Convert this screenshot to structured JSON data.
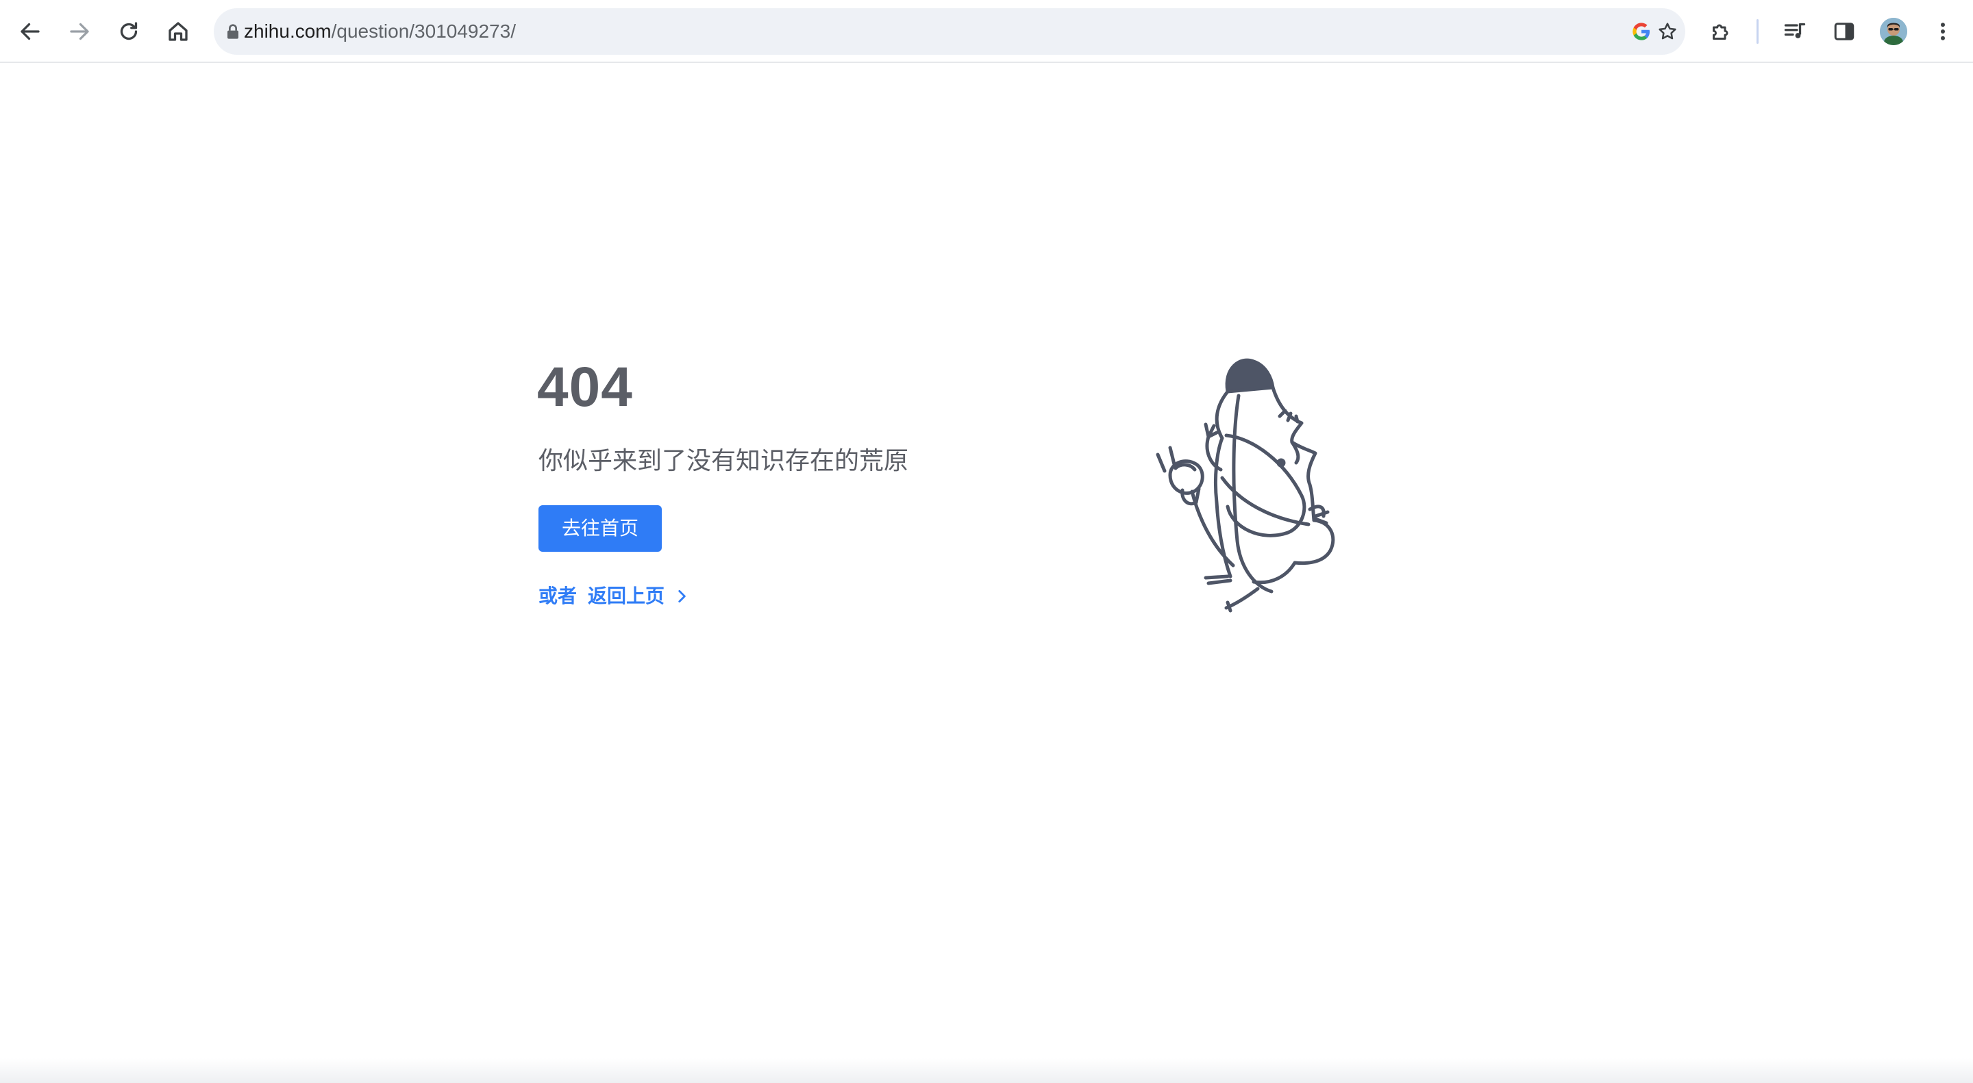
{
  "browser": {
    "url_host": "zhihu.com",
    "url_path": "/question/301049273/",
    "icons": {
      "back": "arrow-left-icon",
      "forward": "arrow-right-icon",
      "reload": "reload-icon",
      "home": "home-icon",
      "lock": "lock-icon",
      "google": "google-icon",
      "bookmark": "star-icon",
      "extensions": "puzzle-icon",
      "media": "media-queue-icon",
      "side_panel": "side-panel-icon",
      "profile": "avatar",
      "menu": "kebab-menu-icon"
    }
  },
  "page": {
    "title": "404",
    "subtitle": "你似乎来到了没有知识存在的荒原",
    "home_button": "去往首页",
    "or_label": "或者",
    "back_link": "返回上页",
    "illustration": "unplugged-character-illustration"
  },
  "colors": {
    "accent": "#2f7cf6",
    "text": "#5b5e66",
    "illustration": "#4e5566"
  }
}
